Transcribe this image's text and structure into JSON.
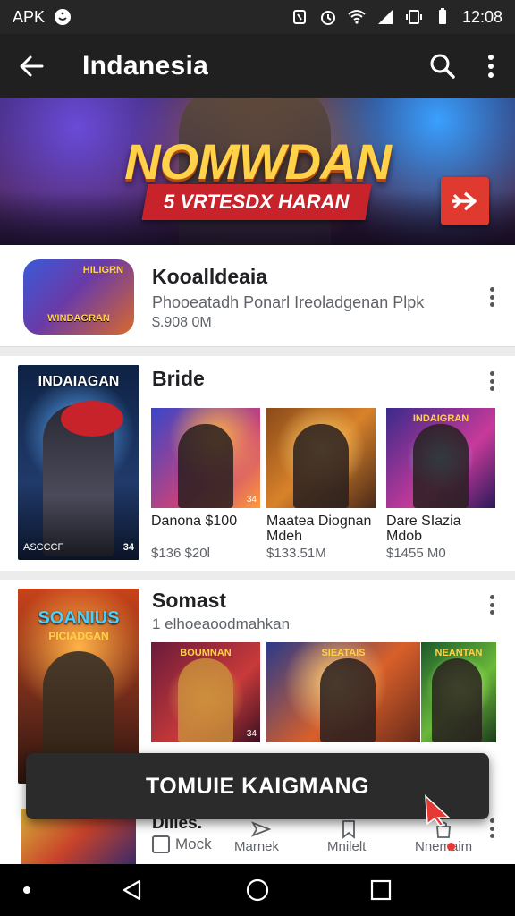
{
  "status_bar": {
    "carrier": "APK",
    "time": "12:08",
    "icons": [
      "smiley-icon",
      "nfc-icon",
      "alarm-icon",
      "wifi-icon",
      "signal-icon",
      "vibrate-icon",
      "battery-icon"
    ]
  },
  "app_bar": {
    "title": "Indanesia",
    "back_icon": "arrow-left-icon",
    "search_icon": "search-icon",
    "menu_icon": "more-vert-icon"
  },
  "hero": {
    "headline": "NOMWDAN",
    "ribbon": "5 VRTESDX HARAN",
    "play_icon": "play-arrow-icon",
    "accent": "#e0392f"
  },
  "featured": {
    "name": "Kooalldeaia",
    "subtitle": "Phooeatadh Ponarl Ireoladgenan Plpk",
    "meta": "$.908 0M",
    "thumb_top": "HILIGRN",
    "thumb_label": "WINDAGRAN"
  },
  "section1": {
    "title": "Bride",
    "poster": {
      "title": "INDAIAGAN",
      "footer": "ASCCCF",
      "badge": "34"
    },
    "items": [
      {
        "caption": "Danona $100",
        "price": "$136 $20l",
        "tag": "34"
      },
      {
        "caption": "Maatea Diognan Mdeh",
        "price": "$133.51M",
        "tag": ""
      },
      {
        "caption": "Dare SIazia Mdob",
        "price": "$1455 M0",
        "tag": ""
      }
    ],
    "tile3_title": "INDAIGRAN"
  },
  "section2": {
    "title": "Somast",
    "subtitle": "1 elhoeaoodmahkan",
    "poster": {
      "title": "SOANIUS",
      "subtitle": "PICIADGAN"
    },
    "items": [
      {
        "title": "BOUMNAN",
        "tag": "34"
      },
      {
        "title": "SIEATAIS",
        "tag": ""
      },
      {
        "title": "NEANTAN",
        "tag": ""
      }
    ]
  },
  "section3": {
    "name": "Dilles.",
    "mock": "Mock",
    "tabs": [
      "Marnek",
      "Mnilelt",
      "Nnemaim"
    ]
  },
  "snackbar": {
    "text": "TOMUIE KAIGMANG"
  },
  "nav_bar": {
    "icons": [
      "back-triangle-icon",
      "home-circle-icon",
      "recents-square-icon"
    ]
  }
}
